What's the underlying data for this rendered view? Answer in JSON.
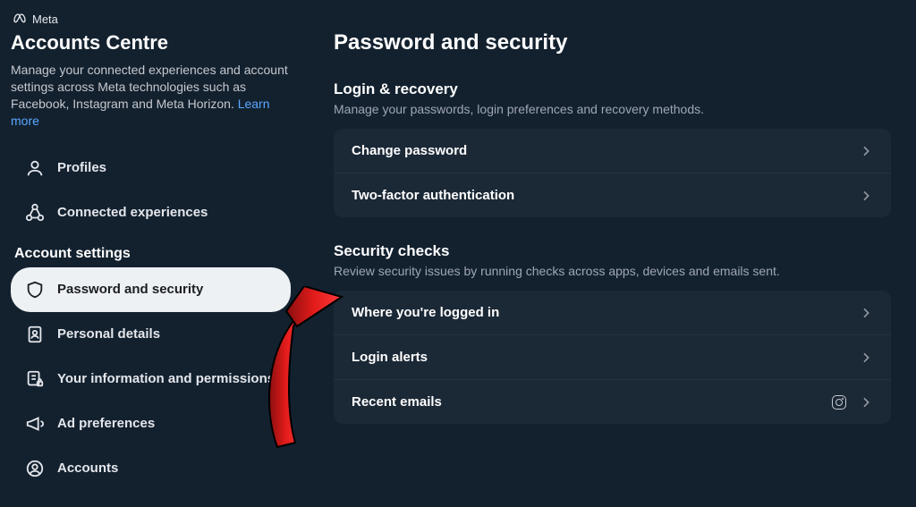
{
  "brand": "Meta",
  "sidebar": {
    "title": "Accounts Centre",
    "description": "Manage your connected experiences and account settings across Meta technologies such as Facebook, Instagram and Meta Horizon. ",
    "learn_more": "Learn more",
    "nav": [
      {
        "label": "Profiles"
      },
      {
        "label": "Connected experiences"
      }
    ],
    "settings_heading": "Account settings",
    "settings_nav": [
      {
        "label": "Password and security"
      },
      {
        "label": "Personal details"
      },
      {
        "label": "Your information and permissions"
      },
      {
        "label": "Ad preferences"
      },
      {
        "label": "Accounts"
      }
    ]
  },
  "main": {
    "title": "Password and security",
    "groups": [
      {
        "title": "Login & recovery",
        "sub": "Manage your passwords, login preferences and recovery methods.",
        "rows": [
          {
            "label": "Change password"
          },
          {
            "label": "Two-factor authentication"
          }
        ]
      },
      {
        "title": "Security checks",
        "sub": "Review security issues by running checks across apps, devices and emails sent.",
        "rows": [
          {
            "label": "Where you're logged in"
          },
          {
            "label": "Login alerts"
          },
          {
            "label": "Recent emails"
          }
        ]
      }
    ]
  }
}
